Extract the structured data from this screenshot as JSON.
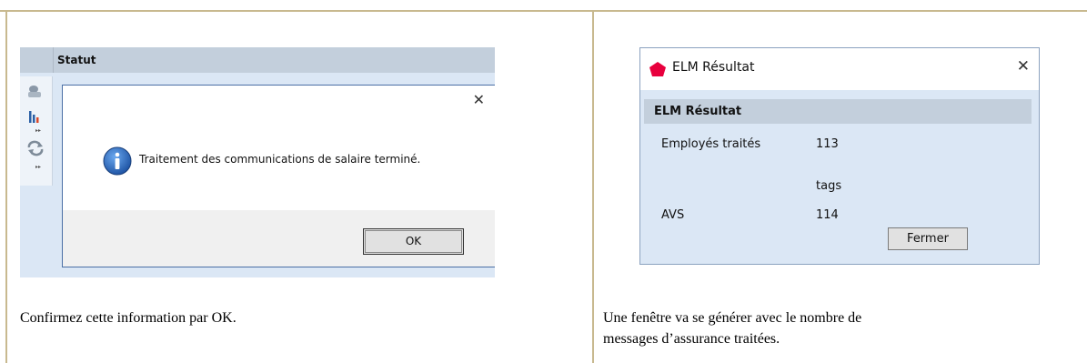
{
  "left": {
    "column_header": "Statut",
    "toolbar_icons": [
      "people-icon",
      "bar-chart-icon",
      "expand-arrow-icon",
      "refresh-icon",
      "expand-arrow-icon"
    ],
    "dialog": {
      "icon": "info-icon",
      "message": "Traitement des communications de salaire terminé.",
      "ok_label": "OK",
      "close_glyph": "✕"
    },
    "caption": "Confirmez cette information par OK."
  },
  "right": {
    "window": {
      "title": "ELM Résultat",
      "close_glyph": "✕",
      "logo_color": "#e8003d",
      "section_title": "ELM Résultat",
      "employees_label": "Employés traités",
      "employees_value": "113",
      "tags_label": "tags",
      "avs_label": "AVS",
      "avs_value": "114",
      "close_button_label": "Fermer"
    },
    "caption_line1": "Une fenêtre va se générer avec le nombre de",
    "caption_line2": "messages d’assurance traitées."
  }
}
